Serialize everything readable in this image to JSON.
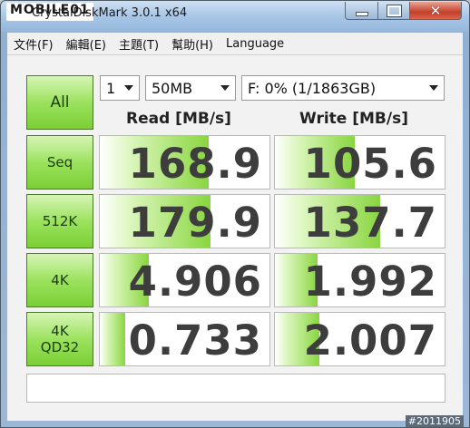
{
  "window": {
    "logo": "MOBILE01",
    "title": "CrystalDiskMark 3.0.1 x64",
    "min_icon": "minimize-icon",
    "max_icon": "maximize-icon",
    "close_icon": "close-icon",
    "close_glyph": "✕"
  },
  "menu": [
    "文件(F)",
    "編輯(E)",
    "主題(T)",
    "幫助(H)",
    "Language"
  ],
  "controls": {
    "all_label": "All",
    "runs": "1",
    "size": "50MB",
    "drive": "F: 0% (1/1863GB)"
  },
  "headers": {
    "read": "Read [MB/s]",
    "write": "Write [MB/s]"
  },
  "rows": [
    {
      "label": "Seq",
      "read": "168.9",
      "write": "105.6",
      "read_fill": 0.64,
      "write_fill": 0.47
    },
    {
      "label": "512K",
      "read": "179.9",
      "write": "137.7",
      "read_fill": 0.65,
      "write_fill": 0.62
    },
    {
      "label": "4K",
      "read": "4.906",
      "write": "1.992",
      "read_fill": 0.29,
      "write_fill": 0.25
    },
    {
      "label": "4K\nQD32",
      "read": "0.733",
      "write": "2.007",
      "read_fill": 0.15,
      "write_fill": 0.26
    }
  ],
  "status_text": "",
  "watermark": "#2011905"
}
